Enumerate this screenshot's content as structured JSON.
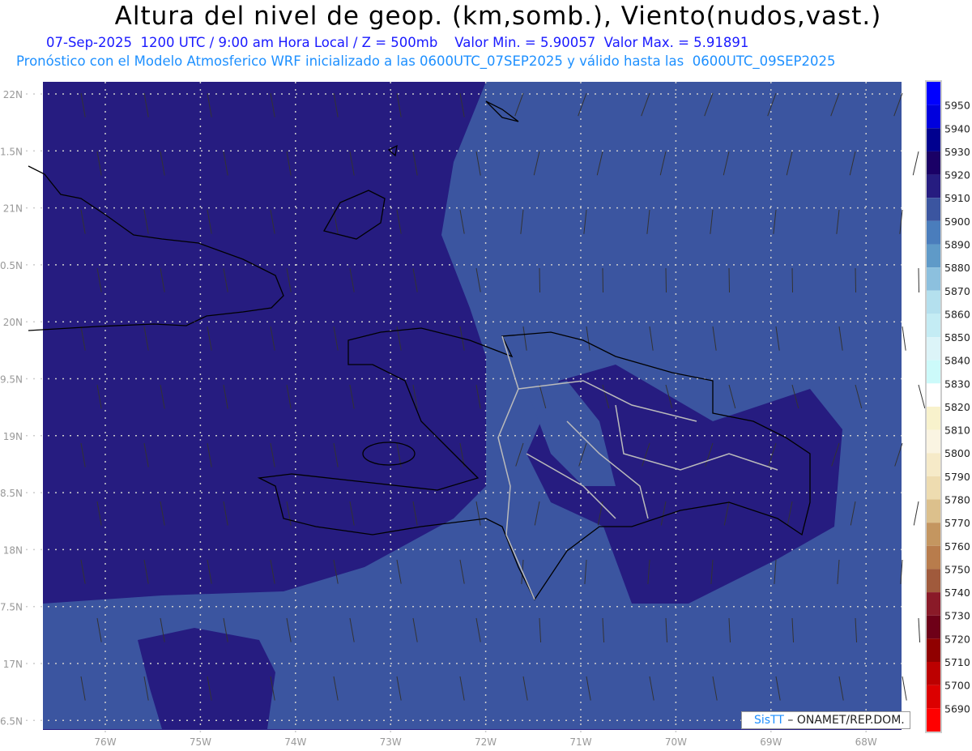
{
  "title": "Altura del nivel de geop. (km,somb.), Viento(nudos,vast.)",
  "subtitle": "07-Sep-2025  1200 UTC / 9:00 am Hora Local / Z = 500mb    Valor Min. = 5.90057  Valor Max. = 5.91891",
  "forecast_line": "Pronóstico con el Modelo Atmosferico WRF inicializado a las 0600UTC_07SEP2025 y válido hasta las  0600UTC_09SEP2025",
  "map": {
    "lat_labels": [
      "22N",
      "1.5N",
      "21N",
      "0.5N",
      "20N",
      "9.5N",
      "19N",
      "8.5N",
      "18N",
      "7.5N",
      "17N",
      "6.5N"
    ],
    "lon_labels": [
      "76W",
      "75W",
      "74W",
      "73W",
      "72W",
      "71W",
      "70W",
      "69W",
      "68W"
    ],
    "fill_colors": {
      "dark": "#261c80",
      "light": "#3b55a0"
    }
  },
  "colorbar": {
    "labels": [
      "5950",
      "5940",
      "5930",
      "5920",
      "5910",
      "5900",
      "5890",
      "5880",
      "5870",
      "5860",
      "5850",
      "5840",
      "5830",
      "5820",
      "5810",
      "5800",
      "5790",
      "5780",
      "5770",
      "5760",
      "5750",
      "5740",
      "5730",
      "5720",
      "5710",
      "5700",
      "5690"
    ],
    "colors": [
      "#0000ff",
      "#0000dd",
      "#00008f",
      "#1a0066",
      "#261c80",
      "#3b55a0",
      "#4a7dbc",
      "#5f9ac8",
      "#8cc0de",
      "#b4e0ee",
      "#c4ecf4",
      "#dcf4f8",
      "#ccfafa",
      "#ffffff",
      "#f8f2cc",
      "#faf4e2",
      "#f6eac8",
      "#eedcb0",
      "#dcc08c",
      "#c49660",
      "#b87c4c",
      "#a05a3c",
      "#8a1a28",
      "#6e0018",
      "#900000",
      "#bc0000",
      "#dc0000",
      "#ff0000"
    ]
  },
  "logo": {
    "brand": "SisTT",
    "credit": "– ONAMET/REP.DOM."
  }
}
